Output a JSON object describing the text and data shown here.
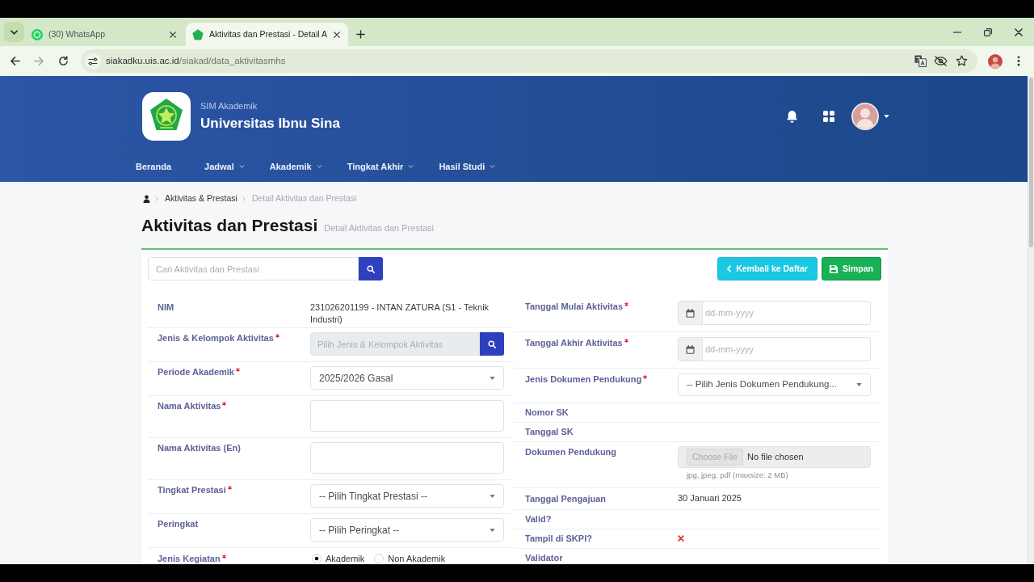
{
  "browser": {
    "tabs": [
      {
        "kind": "whatsapp",
        "title": "(30) WhatsApp",
        "selected": false
      },
      {
        "kind": "site",
        "title": "Aktivitas dan Prestasi - Detail A",
        "selected": true
      }
    ],
    "url": {
      "host": "siakadku.uis.ac.id",
      "path": "/siakad/data_aktivitasmhs"
    }
  },
  "header": {
    "app_name": "SIM Akademik",
    "title": "Universitas Ibnu Sina",
    "nav": [
      {
        "label": "Beranda",
        "dropdown": false
      },
      {
        "label": "Jadwal",
        "dropdown": true
      },
      {
        "label": "Akademik",
        "dropdown": true
      },
      {
        "label": "Tingkat Akhir",
        "dropdown": true
      },
      {
        "label": "Hasil Studi",
        "dropdown": true
      }
    ]
  },
  "breadcrumb": [
    {
      "label": "Aktivitas & Prestasi",
      "current": false
    },
    {
      "label": "Detail Aktivitas dan Prestasi",
      "current": true
    }
  ],
  "page": {
    "title": "Aktivitas dan Prestasi",
    "subtitle": "Detail Aktivitas dan Prestasi"
  },
  "search": {
    "placeholder": "Cari Aktivitas dan Prestasi"
  },
  "actions": [
    {
      "kind": "back",
      "label": "Kembali ke Daftar"
    },
    {
      "kind": "save",
      "label": "Simpan"
    }
  ],
  "left_fields": [
    {
      "kind": "text",
      "label": "NIM",
      "required": false,
      "value": "231026201199 - INTAN ZATURA (S1 - Teknik Industri)"
    },
    {
      "kind": "lookup",
      "label": "Jenis & Kelompok Aktivitas",
      "required": true,
      "placeholder": "Pilih Jenis & Kelompok Aktivitas",
      "disabled": true
    },
    {
      "kind": "select",
      "label": "Periode Akademik",
      "required": true,
      "value": "2025/2026 Gasal"
    },
    {
      "kind": "textarea",
      "label": "Nama Aktivitas",
      "required": true
    },
    {
      "kind": "textarea",
      "label": "Nama Aktivitas (En)",
      "required": false
    },
    {
      "kind": "select",
      "label": "Tingkat Prestasi",
      "required": true,
      "value": "-- Pilih Tingkat Prestasi --"
    },
    {
      "kind": "select",
      "label": "Peringkat",
      "required": false,
      "value": "-- Pilih Peringkat --"
    },
    {
      "kind": "radio",
      "label": "Jenis Kegiatan",
      "required": true,
      "options": [
        {
          "label": "Akademik",
          "selected": true
        },
        {
          "label": "Non Akademik",
          "selected": false
        }
      ]
    }
  ],
  "right_fields": [
    {
      "kind": "date",
      "label": "Tanggal Mulai Aktivitas",
      "required": true,
      "placeholder": "dd-mm-yyyy"
    },
    {
      "kind": "date",
      "label": "Tanggal Akhir Aktivitas",
      "required": true,
      "placeholder": "dd-mm-yyyy"
    },
    {
      "kind": "select",
      "label": "Jenis Dokumen Pendukung",
      "required": true,
      "value": "-- Pilih Jenis Dokumen Pendukung..."
    },
    {
      "kind": "empty",
      "label": "Nomor SK",
      "required": false
    },
    {
      "kind": "empty",
      "label": "Tanggal SK",
      "required": false
    },
    {
      "kind": "file",
      "label": "Dokumen Pendukung",
      "required": false,
      "button": "Choose File",
      "status": "No file chosen",
      "help": "jpg, jpeg, pdf (maxsize: 2 MB)"
    },
    {
      "kind": "text",
      "label": "Tanggal Pengajuan",
      "required": false,
      "value": "30 Januari 2025"
    },
    {
      "kind": "empty",
      "label": "Valid?",
      "required": false
    },
    {
      "kind": "flag",
      "label": "Tampil di SKPI?",
      "required": false,
      "on": false
    },
    {
      "kind": "empty",
      "label": "Validator",
      "required": false
    }
  ]
}
